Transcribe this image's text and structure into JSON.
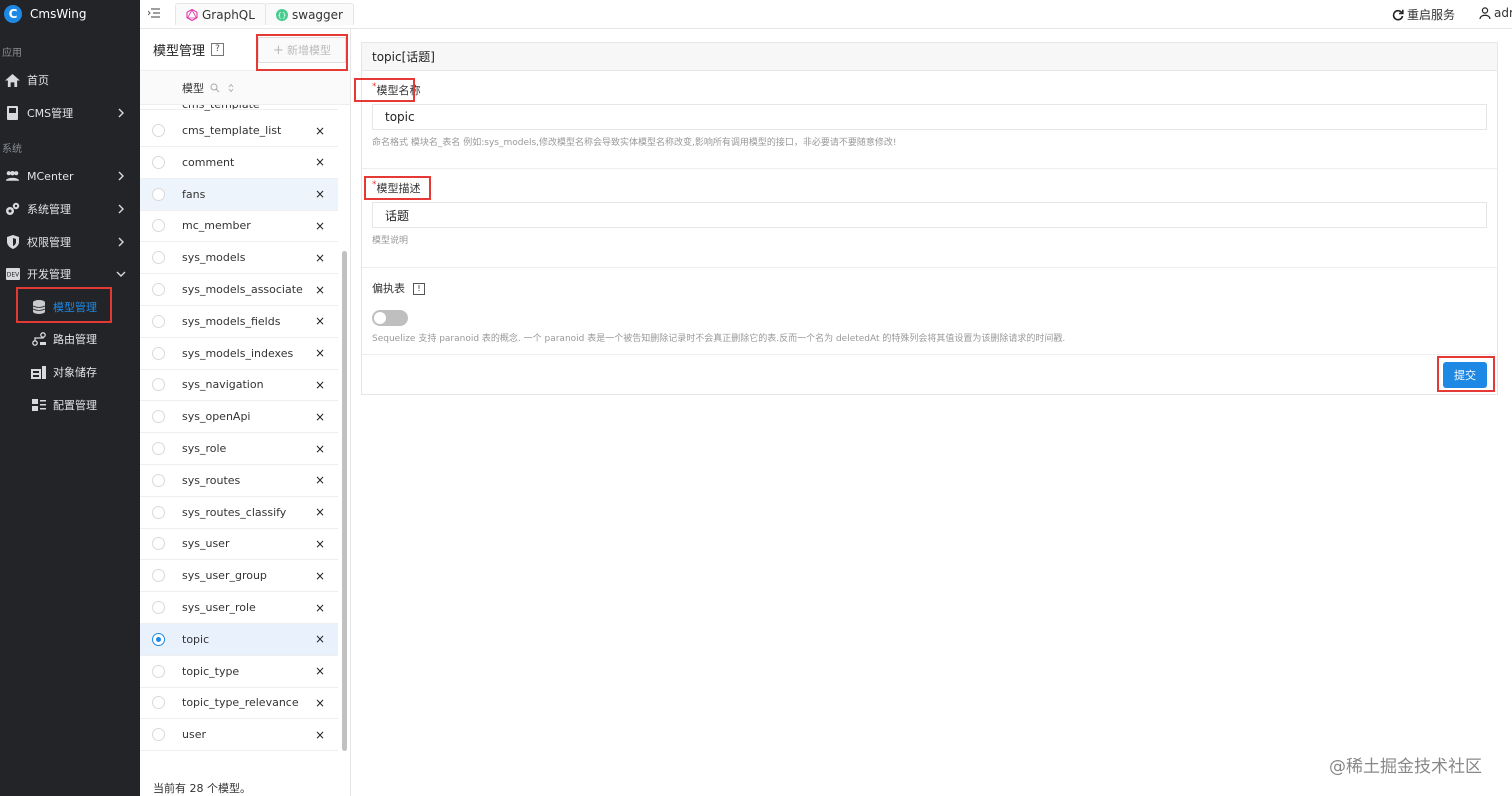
{
  "brand": {
    "name": "CmsWing"
  },
  "sidebar": {
    "group_app": "应用",
    "group_system": "系统",
    "items": [
      {
        "label": "首页"
      },
      {
        "label": "CMS管理"
      },
      {
        "label": "MCenter"
      },
      {
        "label": "系统管理"
      },
      {
        "label": "权限管理"
      },
      {
        "label": "开发管理"
      },
      {
        "label": "模型管理"
      },
      {
        "label": "路由管理"
      },
      {
        "label": "对象储存"
      },
      {
        "label": "配置管理"
      }
    ]
  },
  "topbar": {
    "tabs": [
      {
        "label": "GraphQL"
      },
      {
        "label": "swagger"
      }
    ],
    "restart_label": "重启服务",
    "user_label": "adm"
  },
  "model_panel": {
    "title": "模型管理",
    "help_icon": "?",
    "add_button_label": "新增模型",
    "column_header": "模型",
    "cutoff_row": "cms_template",
    "rows": [
      {
        "name": "cms_template_list"
      },
      {
        "name": "comment"
      },
      {
        "name": "fans"
      },
      {
        "name": "mc_member"
      },
      {
        "name": "sys_models"
      },
      {
        "name": "sys_models_associate"
      },
      {
        "name": "sys_models_fields"
      },
      {
        "name": "sys_models_indexes"
      },
      {
        "name": "sys_navigation"
      },
      {
        "name": "sys_openApi"
      },
      {
        "name": "sys_role"
      },
      {
        "name": "sys_routes"
      },
      {
        "name": "sys_routes_classify"
      },
      {
        "name": "sys_user"
      },
      {
        "name": "sys_user_group"
      },
      {
        "name": "sys_user_role"
      },
      {
        "name": "topic"
      },
      {
        "name": "topic_type"
      },
      {
        "name": "topic_type_relevance"
      },
      {
        "name": "user"
      }
    ],
    "delete_symbol": "×",
    "selected_row": "topic",
    "footer": "当前有 28 个模型。"
  },
  "form": {
    "header": "topic[话题]",
    "name_label": "模型名称",
    "name_value": "topic",
    "name_hint": "命名格式 模块名_表名 例如:sys_models,修改模型名称会导致实体模型名称改变,影响所有调用模型的接口，非必要请不要随意修改!",
    "desc_label": "模型描述",
    "desc_value": "话题",
    "desc_hint": "模型说明",
    "paranoid_label": "偏执表",
    "paranoid_info": "!",
    "paranoid_hint": "Sequelize 支持 paranoid 表的概念. 一个 paranoid 表是一个被告知删除记录时不会真正删除它的表.反而一个名为 deletedAt 的特殊列会将其值设置为该删除请求的时间戳.",
    "paranoid_enabled": false,
    "required_mark": "*",
    "submit_label": "提交"
  },
  "watermark": "@稀土掘金技术社区"
}
